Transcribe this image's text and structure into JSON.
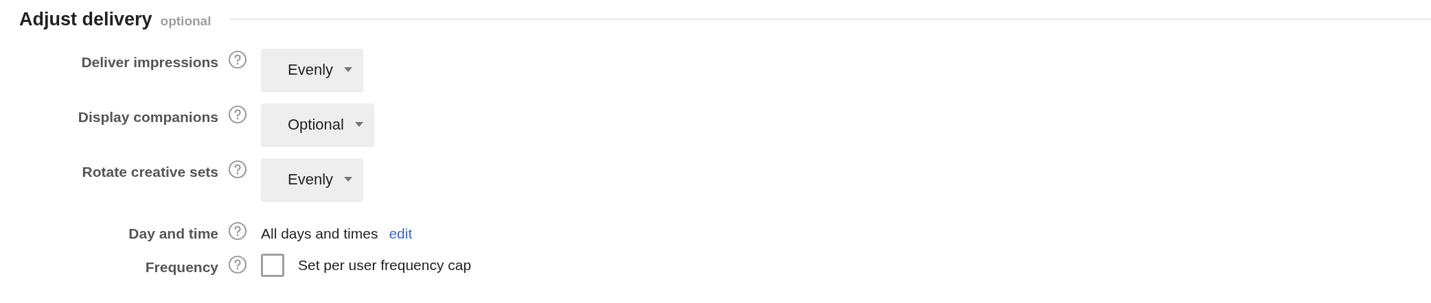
{
  "section": {
    "title": "Adjust delivery",
    "tag": "optional"
  },
  "rows": [
    {
      "kind": "select",
      "label": "Deliver impressions",
      "value": "Evenly"
    },
    {
      "kind": "select",
      "label": "Display companions",
      "value": "Optional"
    },
    {
      "kind": "select",
      "label": "Rotate creative sets",
      "value": "Evenly"
    },
    {
      "kind": "text_link",
      "label": "Day and time",
      "value": "All days and times",
      "link": "edit"
    },
    {
      "kind": "checkbox",
      "label": "Frequency",
      "checked": false,
      "text": "Set per user frequency cap"
    }
  ]
}
